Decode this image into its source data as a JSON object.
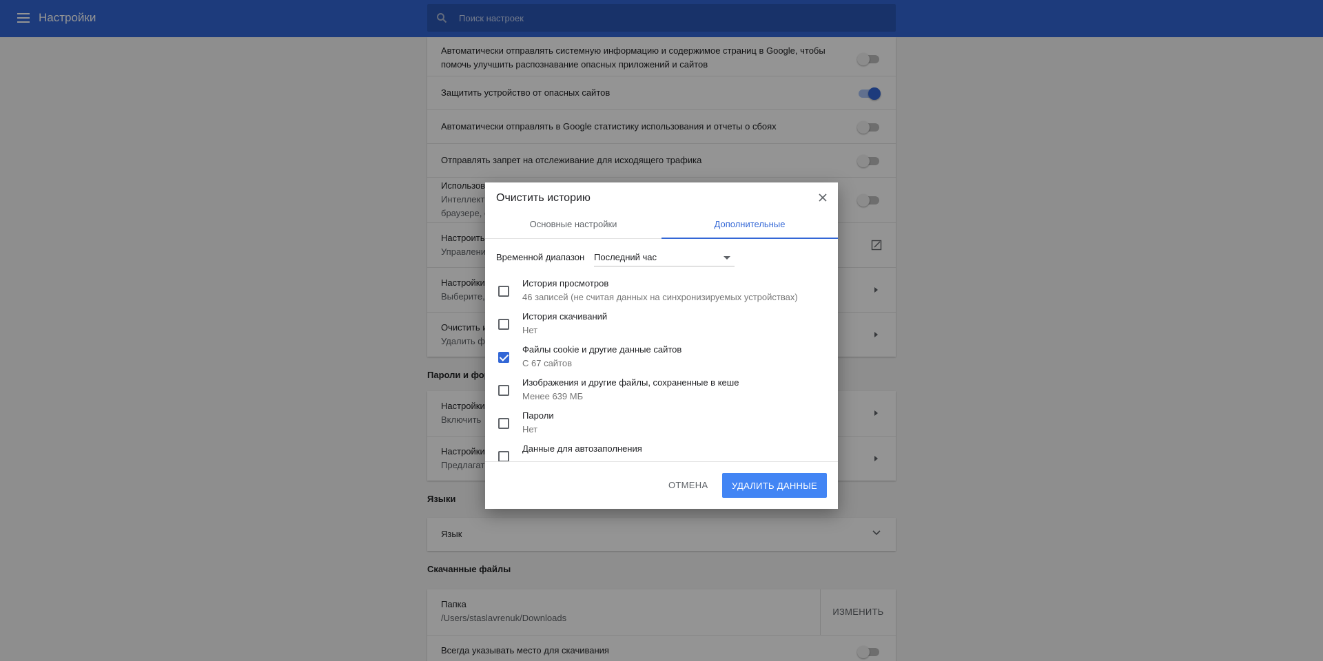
{
  "header": {
    "title": "Настройки",
    "search_placeholder": "Поиск настроек"
  },
  "privacy": {
    "rows": [
      {
        "title": "Автоматически отправлять системную информацию и содержимое страниц в Google, чтобы",
        "title2": "помочь улучшить распознавание опасных приложений и сайтов",
        "toggle": false
      },
      {
        "title": "Защитить устройство от опасных сайтов",
        "toggle": true
      },
      {
        "title": "Автоматически отправлять в Google статистику использования и отчеты о сбоях",
        "toggle": false
      },
      {
        "title": "Отправлять запрет на отслеживание для исходящего трафика",
        "toggle": false
      },
      {
        "title": "Использов",
        "sub": "Интеллект",
        "sub2": "браузере, с",
        "toggle": false
      },
      {
        "title": "Настроить",
        "sub": "Управлени"
      },
      {
        "title": "Настройки",
        "sub": "Выберите, "
      },
      {
        "title": "Очистить и",
        "sub": "Удалить ф"
      }
    ]
  },
  "passwords": {
    "section_title": "Пароли и фор",
    "rows": [
      {
        "title": "Настройки",
        "sub": "Включить"
      },
      {
        "title": "Настройки",
        "sub": "Предлагат"
      }
    ]
  },
  "languages": {
    "section_title": "Языки",
    "row_title": "Язык"
  },
  "downloads": {
    "section_title": "Скачанные файлы",
    "folder_title": "Папка",
    "folder_path": "/Users/staslavrenuk/Downloads",
    "change_label": "ИЗМЕНИТЬ",
    "ask_title": "Всегда указывать место для скачивания"
  },
  "dialog": {
    "title": "Очистить историю",
    "tabs": [
      {
        "label": "Основные настройки",
        "active": false
      },
      {
        "label": "Дополнительные",
        "active": true
      }
    ],
    "time_range_label": "Временной диапазон",
    "time_range_value": "Последний час",
    "items": [
      {
        "title": "История просмотров",
        "sub": "46 записей (не считая данных на синхронизируемых устройствах)",
        "checked": false
      },
      {
        "title": "История скачиваний",
        "sub": "Нет",
        "checked": false
      },
      {
        "title": "Файлы cookie и другие данные сайтов",
        "sub": "С 67 сайтов",
        "checked": true
      },
      {
        "title": "Изображения и другие файлы, сохраненные в кеше",
        "sub": "Менее 639 МБ",
        "checked": false
      },
      {
        "title": "Пароли",
        "sub": "Нет",
        "checked": false
      },
      {
        "title": "Данные для автозаполнения",
        "sub": "",
        "checked": false
      }
    ],
    "cancel_label": "ОТМЕНА",
    "delete_label": "УДАЛИТЬ ДАННЫЕ"
  },
  "colors": {
    "header": "#3367d6",
    "accent": "#4285f4"
  }
}
